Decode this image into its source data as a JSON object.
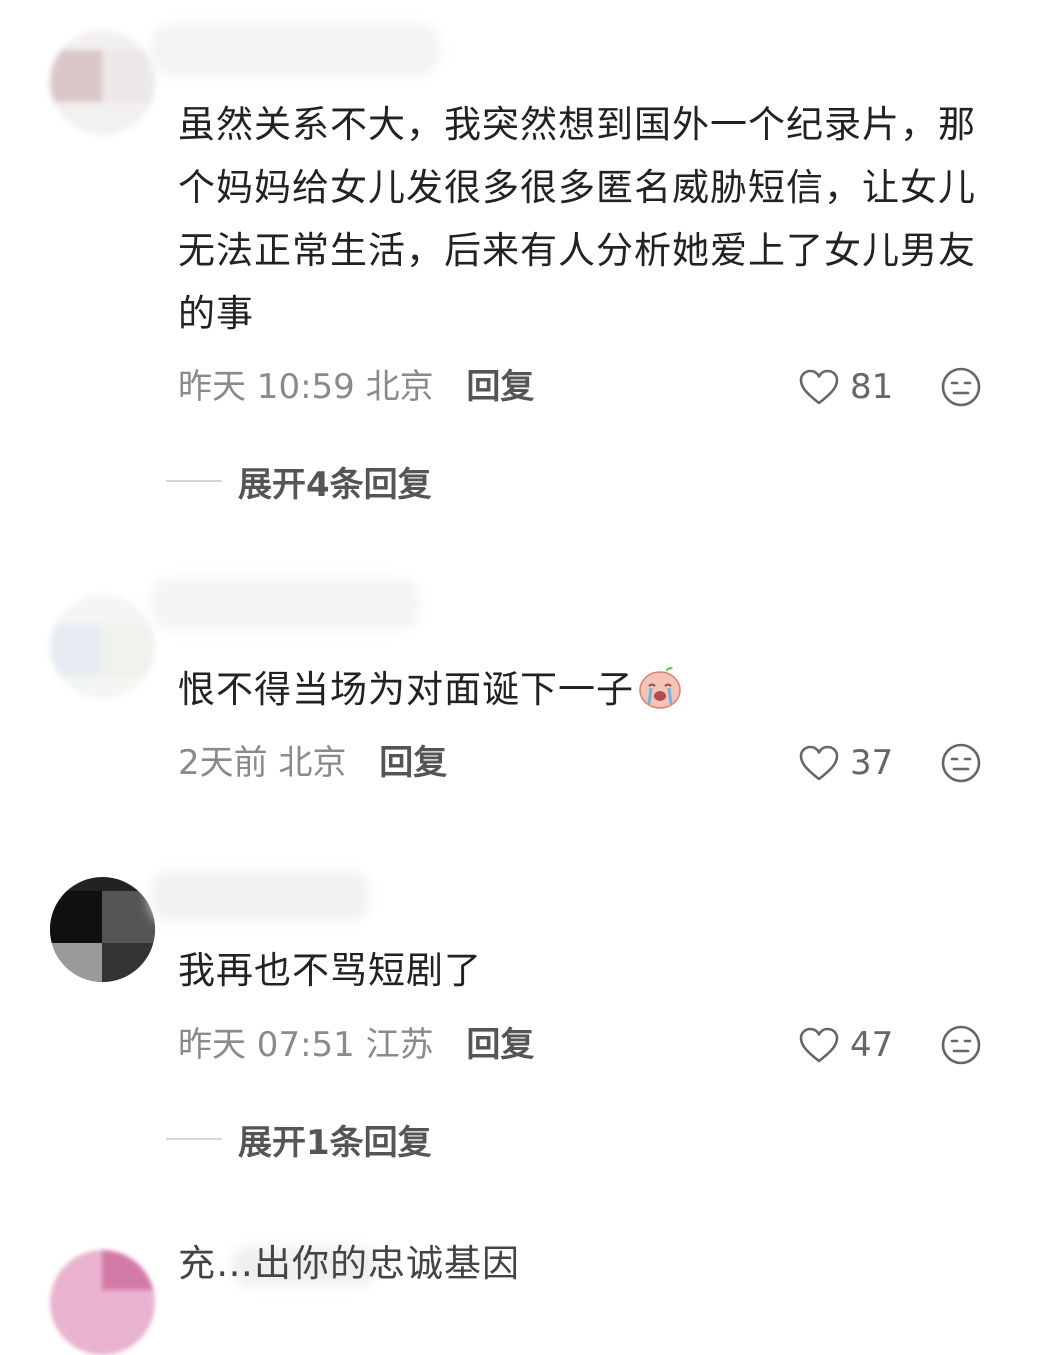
{
  "comments": [
    {
      "text": "虽然关系不大，我突然想到国外一个纪录片，那个妈妈给女儿发很多很多匿名威胁短信，让女儿无法正常生活，后来有人分析她爱上了女儿男友的事",
      "time": "昨天 10:59",
      "location": "北京",
      "reply_label": "回复",
      "likes": "81",
      "expand_label": "展开4条回复"
    },
    {
      "text": "恨不得当场为对面诞下一子",
      "time": "2天前",
      "location": "北京",
      "reply_label": "回复",
      "likes": "37",
      "emoji": "crying-face-emoji"
    },
    {
      "text": "我再也不骂短剧了",
      "time": "昨天 07:51",
      "location": "江苏",
      "reply_label": "回复",
      "likes": "47",
      "expand_label": "展开1条回复"
    },
    {
      "text": "充…出你的忠诚基因"
    }
  ],
  "icons": {
    "like": "heart-outline-icon",
    "dislike": "neutral-face-icon"
  },
  "colors": {
    "text": "#222222",
    "meta": "#8a8a8a",
    "icon": "#666666"
  }
}
